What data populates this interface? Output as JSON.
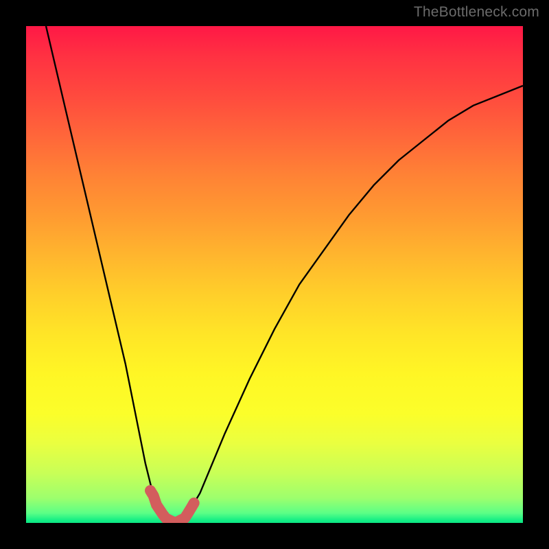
{
  "watermark": "TheBottleneck.com",
  "chart_data": {
    "type": "line",
    "title": "",
    "xlabel": "",
    "ylabel": "",
    "xlim": [
      0,
      100
    ],
    "ylim": [
      0,
      100
    ],
    "background": "rainbow-vertical-gradient",
    "series": [
      {
        "name": "bottleneck-curve",
        "x": [
          4,
          8,
          12,
          16,
          20,
          22,
          24,
          26,
          28,
          30,
          32,
          35,
          40,
          45,
          50,
          55,
          60,
          65,
          70,
          75,
          80,
          85,
          90,
          95,
          100
        ],
        "y": [
          100,
          83,
          66,
          49,
          32,
          22,
          12,
          4,
          1,
          0,
          1,
          6,
          18,
          29,
          39,
          48,
          55,
          62,
          68,
          73,
          77,
          81,
          84,
          86,
          88
        ]
      }
    ],
    "band": {
      "name": "optimal-band",
      "color": "#d35d5d",
      "x_range": [
        25.0,
        33.8
      ],
      "y_range": [
        0,
        6.5
      ]
    },
    "colors": {
      "frame": "#000000",
      "curve": "#000000",
      "band": "#d35d5d",
      "gradient_top": "#ff1846",
      "gradient_mid": "#ffe527",
      "gradient_bottom": "#13ee85"
    }
  }
}
